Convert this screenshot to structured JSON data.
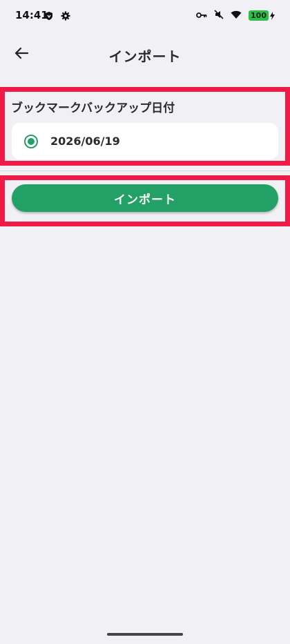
{
  "status_bar": {
    "time": "14:41",
    "battery": "100",
    "icons": [
      "shield-icon",
      "gear-icon",
      "key-icon",
      "mute-icon",
      "wifi-icon",
      "battery-icon"
    ]
  },
  "app_bar": {
    "title": "インポート",
    "back_icon": "arrow-left-icon"
  },
  "backup_section": {
    "label": "ブックマークバックアップ日付",
    "options": [
      {
        "date": "2026/06/19",
        "selected": true
      }
    ]
  },
  "actions": {
    "import_label": "インポート"
  },
  "colors": {
    "accent": "#22a066",
    "highlight": "#ef1a45",
    "background": "#f1f0f5"
  }
}
